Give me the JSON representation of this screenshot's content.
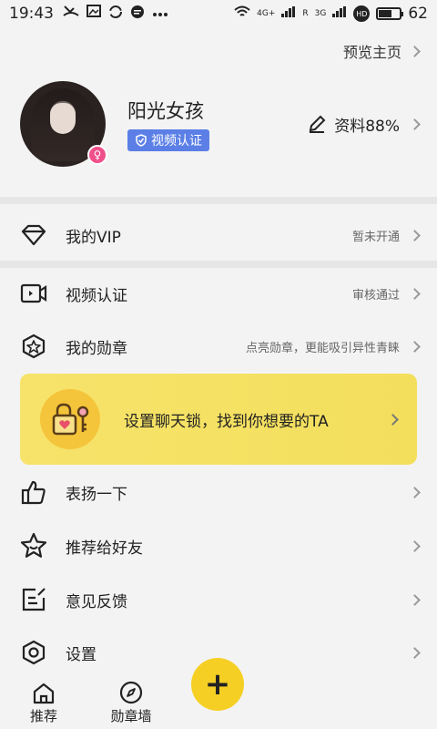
{
  "status_bar": {
    "time": "19:43",
    "left_icons": [
      "missed-call-icon",
      "image-icon",
      "sync-icon",
      "message-icon",
      "more-icon"
    ],
    "network_labels": [
      "4G+",
      "R",
      "3G",
      "HD"
    ],
    "battery_level": 62,
    "battery_text": "62"
  },
  "header": {
    "preview_home": "预览主页"
  },
  "profile": {
    "nickname": "阳光女孩",
    "verify_tag": "视频认证",
    "profile_completion": "资料88%"
  },
  "menu": {
    "vip": {
      "label": "我的VIP",
      "status": "暂未开通"
    },
    "video_verify": {
      "label": "视频认证",
      "status": "审核通过"
    },
    "badges": {
      "label": "我的勋章",
      "status": "点亮勋章，更能吸引异性青睐"
    },
    "banner": {
      "text": "设置聊天锁，找到你想要的TA"
    },
    "praise": {
      "label": "表扬一下"
    },
    "recommend": {
      "label": "推荐给好友"
    },
    "feedback": {
      "label": "意见反馈"
    },
    "settings": {
      "label": "设置"
    }
  },
  "tabbar": {
    "tabs": [
      {
        "label": "推荐",
        "icon": "home-icon"
      },
      {
        "label": "勋章墙",
        "icon": "compass-icon"
      }
    ],
    "fab_label": "+"
  },
  "colors": {
    "accent_yellow": "#f5cf24",
    "banner_yellow": "#f7e36a",
    "verify_blue": "#5b7fe6",
    "gender_pink": "#f0508a"
  }
}
